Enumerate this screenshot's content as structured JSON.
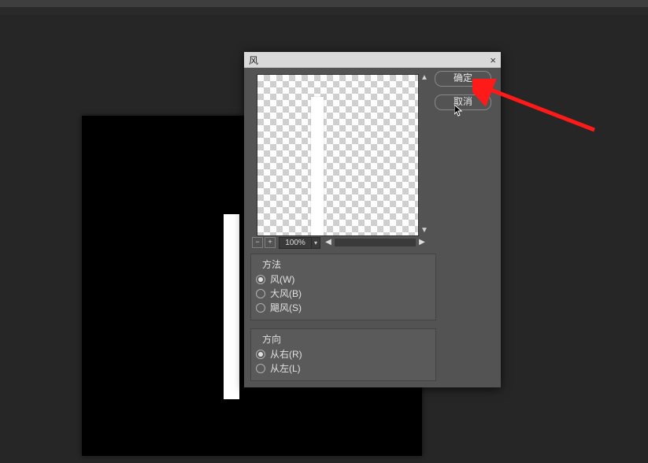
{
  "dialog": {
    "title": "风",
    "close_glyph": "×",
    "zoom": {
      "minus": "−",
      "plus": "+",
      "value": "100%",
      "dropdown_glyph": "▾",
      "nav_left": "◀",
      "nav_right": "▶",
      "scroll_up": "▲",
      "scroll_down": "▼"
    },
    "buttons": {
      "ok": "确定",
      "cancel": "取消"
    },
    "method_group": {
      "title": "方法",
      "options": [
        {
          "label": "风(W)",
          "checked": true
        },
        {
          "label": "大风(B)",
          "checked": false
        },
        {
          "label": "飓风(S)",
          "checked": false
        }
      ]
    },
    "direction_group": {
      "title": "方向",
      "options": [
        {
          "label": "从右(R)",
          "checked": true
        },
        {
          "label": "从左(L)",
          "checked": false
        }
      ]
    }
  }
}
